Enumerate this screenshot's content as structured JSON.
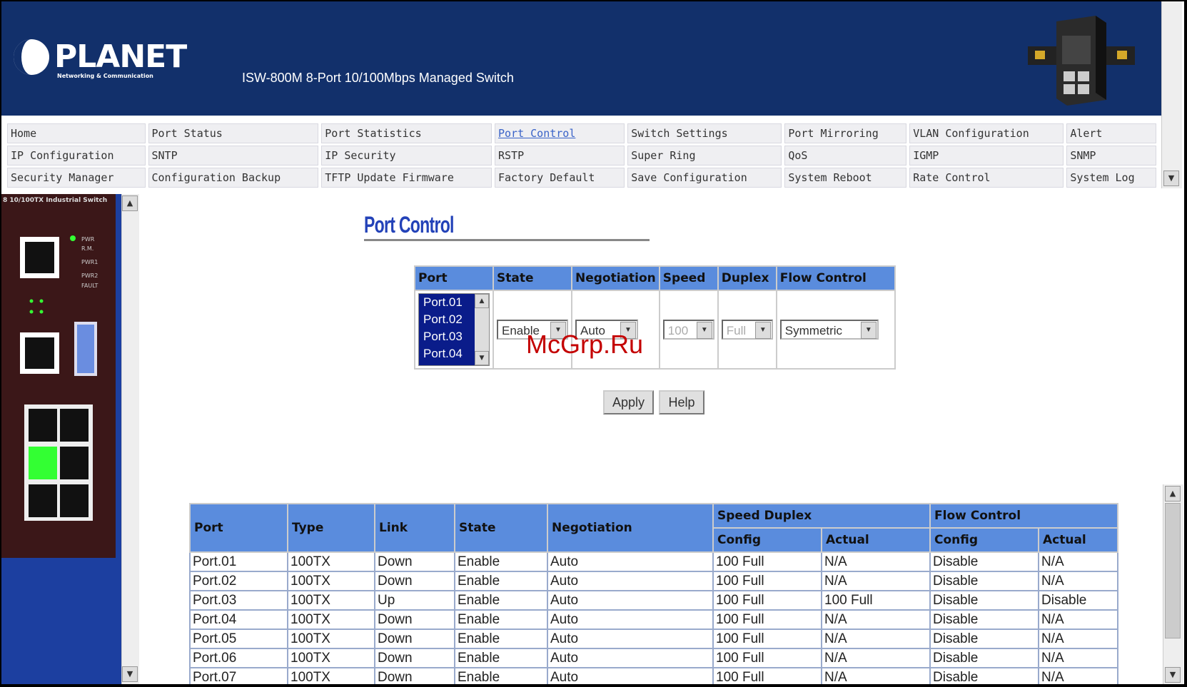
{
  "header": {
    "brand": "PLANET",
    "brand_tagline": "Networking & Communication",
    "product_title": "ISW-800M 8-Port 10/100Mbps Managed Switch"
  },
  "nav": {
    "rows": [
      [
        "Home",
        "Port Status",
        "Port Statistics",
        "Port Control",
        "Switch Settings",
        "Port Mirroring",
        "VLAN Configuration",
        "Alert"
      ],
      [
        "IP Configuration",
        "SNTP",
        "IP Security",
        "RSTP",
        "Super Ring",
        "QoS",
        "IGMP",
        "SNMP"
      ],
      [
        "Security Manager",
        "Configuration Backup",
        "TFTP Update Firmware",
        "Factory Default",
        "Save Configuration",
        "System Reboot",
        "Rate Control",
        "System Log"
      ]
    ],
    "active": "Port Control"
  },
  "sidebar": {
    "panel_title": "8 10/100TX Industrial Switch"
  },
  "main": {
    "title": "Port Control",
    "control_table": {
      "headers": [
        "Port",
        "State",
        "Negotiation",
        "Speed",
        "Duplex",
        "Flow Control"
      ],
      "port_options": [
        "Port.01",
        "Port.02",
        "Port.03",
        "Port.04"
      ],
      "state": "Enable",
      "negotiation": "Auto",
      "speed": "100",
      "duplex": "Full",
      "flow_control": "Symmetric"
    },
    "apply_label": "Apply",
    "help_label": "Help",
    "status_table": {
      "headers": {
        "port": "Port",
        "type": "Type",
        "link": "Link",
        "state": "State",
        "negotiation": "Negotiation",
        "speed_duplex": "Speed Duplex",
        "flow_control": "Flow Control",
        "config": "Config",
        "actual": "Actual"
      },
      "rows": [
        [
          "Port.01",
          "100TX",
          "Down",
          "Enable",
          "Auto",
          "100 Full",
          "N/A",
          "Disable",
          "N/A"
        ],
        [
          "Port.02",
          "100TX",
          "Down",
          "Enable",
          "Auto",
          "100 Full",
          "N/A",
          "Disable",
          "N/A"
        ],
        [
          "Port.03",
          "100TX",
          "Up",
          "Enable",
          "Auto",
          "100 Full",
          "100 Full",
          "Disable",
          "Disable"
        ],
        [
          "Port.04",
          "100TX",
          "Down",
          "Enable",
          "Auto",
          "100 Full",
          "N/A",
          "Disable",
          "N/A"
        ],
        [
          "Port.05",
          "100TX",
          "Down",
          "Enable",
          "Auto",
          "100 Full",
          "N/A",
          "Disable",
          "N/A"
        ],
        [
          "Port.06",
          "100TX",
          "Down",
          "Enable",
          "Auto",
          "100 Full",
          "N/A",
          "Disable",
          "N/A"
        ],
        [
          "Port.07",
          "100TX",
          "Down",
          "Enable",
          "Auto",
          "100 Full",
          "N/A",
          "Disable",
          "N/A"
        ]
      ]
    }
  },
  "watermark": "McGrp.Ru"
}
